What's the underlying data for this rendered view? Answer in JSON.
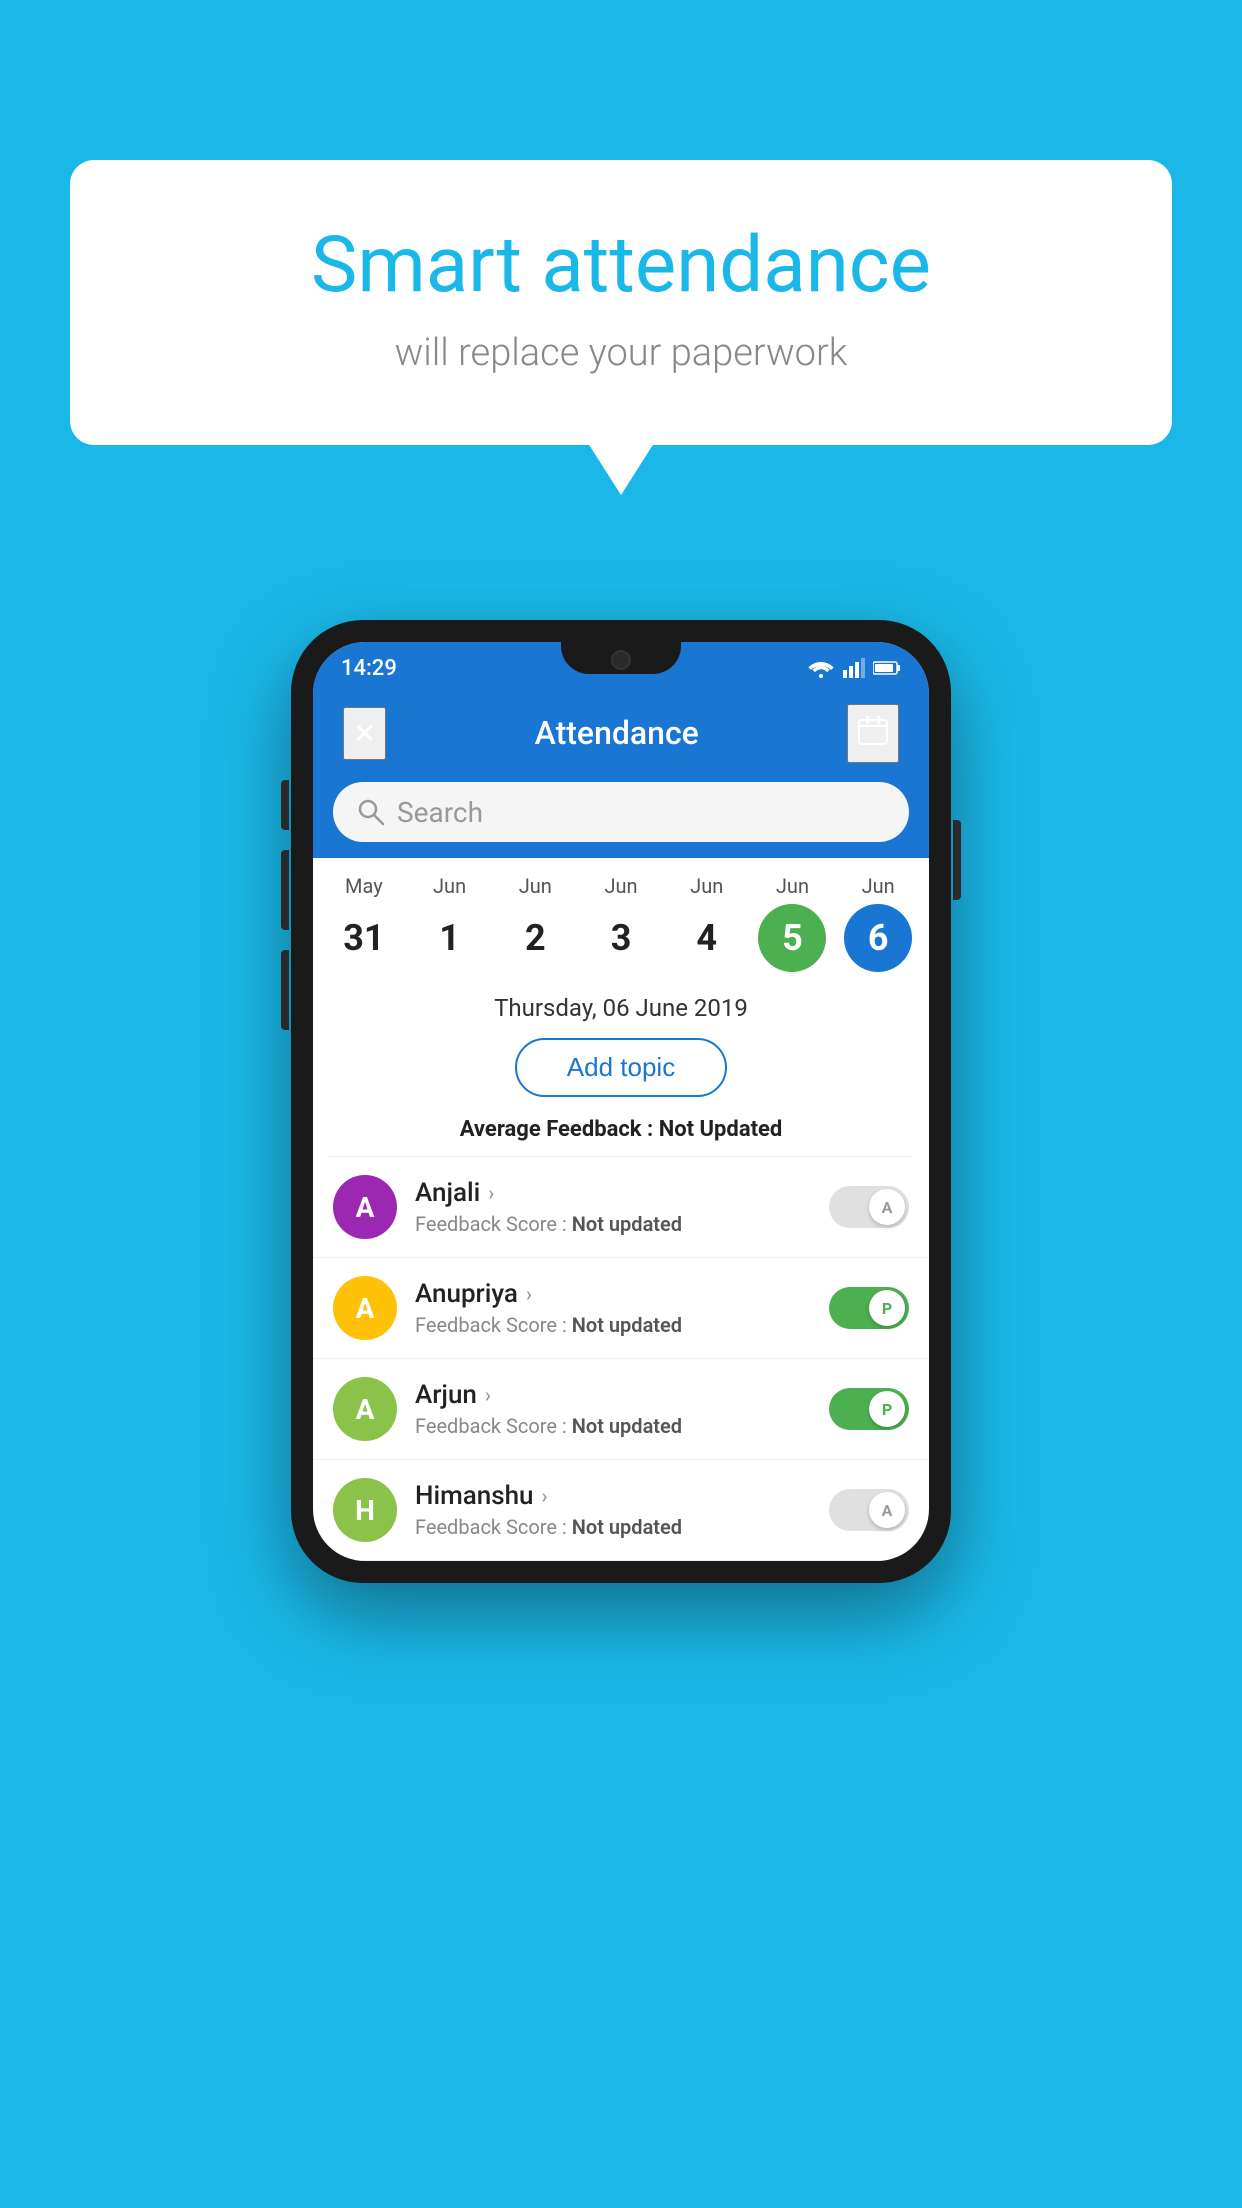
{
  "background_color": "#1ab8e8",
  "speech_bubble": {
    "title": "Smart attendance",
    "subtitle": "will replace your paperwork"
  },
  "status_bar": {
    "time": "14:29",
    "icons": [
      "wifi",
      "signal",
      "battery"
    ]
  },
  "app_bar": {
    "title": "Attendance",
    "close_label": "✕",
    "calendar_label": "📅"
  },
  "search": {
    "placeholder": "Search"
  },
  "calendar": {
    "days": [
      {
        "month": "May",
        "date": "31",
        "state": "normal"
      },
      {
        "month": "Jun",
        "date": "1",
        "state": "normal"
      },
      {
        "month": "Jun",
        "date": "2",
        "state": "normal"
      },
      {
        "month": "Jun",
        "date": "3",
        "state": "normal"
      },
      {
        "month": "Jun",
        "date": "4",
        "state": "normal"
      },
      {
        "month": "Jun",
        "date": "5",
        "state": "today"
      },
      {
        "month": "Jun",
        "date": "6",
        "state": "selected"
      }
    ]
  },
  "selected_date_label": "Thursday, 06 June 2019",
  "add_topic_label": "Add topic",
  "average_feedback": {
    "label": "Average Feedback : ",
    "value": "Not Updated"
  },
  "students": [
    {
      "name": "Anjali",
      "initial": "A",
      "avatar_color": "#9c27b0",
      "feedback_label": "Feedback Score : ",
      "feedback_value": "Not updated",
      "toggle_state": "off",
      "toggle_label": "A"
    },
    {
      "name": "Anupriya",
      "initial": "A",
      "avatar_color": "#ffc107",
      "feedback_label": "Feedback Score : ",
      "feedback_value": "Not updated",
      "toggle_state": "on",
      "toggle_label": "P"
    },
    {
      "name": "Arjun",
      "initial": "A",
      "avatar_color": "#8bc34a",
      "feedback_label": "Feedback Score : ",
      "feedback_value": "Not updated",
      "toggle_state": "on",
      "toggle_label": "P"
    },
    {
      "name": "Himanshu",
      "initial": "H",
      "avatar_color": "#8bc34a",
      "feedback_label": "Feedback Score : ",
      "feedback_value": "Not updated",
      "toggle_state": "off",
      "toggle_label": "A"
    }
  ]
}
